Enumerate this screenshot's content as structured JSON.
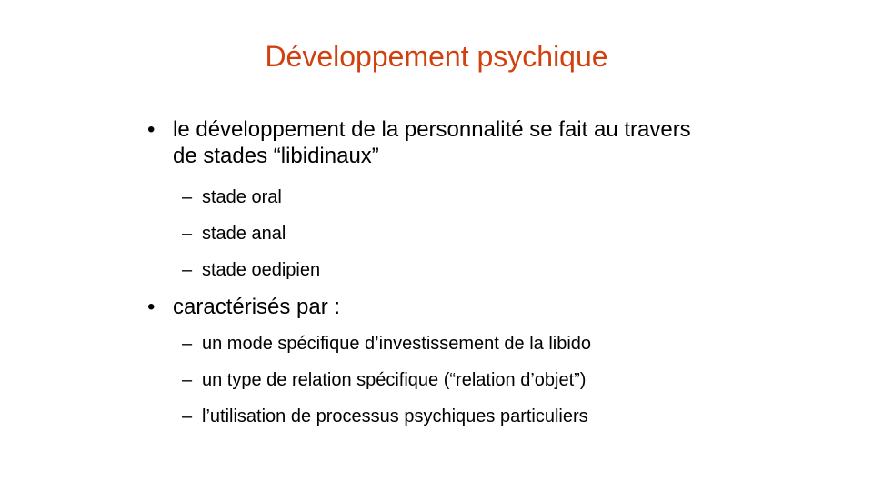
{
  "slide": {
    "title": "Développement psychique",
    "bullet_marker": "•",
    "sub_marker": "–",
    "bullets": [
      {
        "text": "le développement de la personnalité se fait au travers de stades “libidinaux”",
        "subitems": [
          "stade oral",
          "stade anal",
          "stade oedipien"
        ]
      },
      {
        "text": "caractérisés par :",
        "subitems": [
          "un mode spécifique d’investissement de la libido",
          "un type de relation spécifique (“relation d’objet”)",
          "l’utilisation de processus psychiques particuliers"
        ]
      }
    ],
    "colors": {
      "title": "#d1410f",
      "text": "#000000",
      "background": "#ffffff"
    }
  }
}
